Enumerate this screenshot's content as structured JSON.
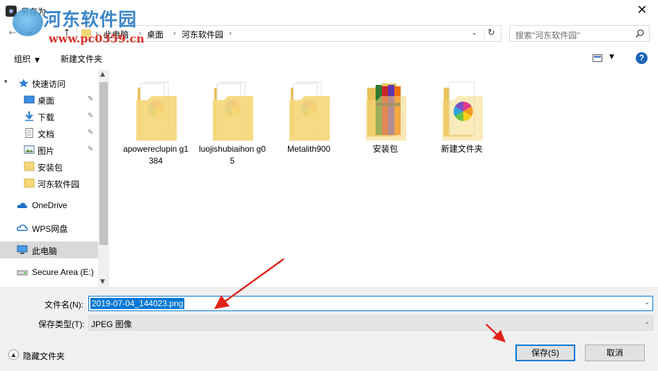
{
  "window": {
    "title": "另存为",
    "close_glyph": "✕"
  },
  "watermark": {
    "title": "河东软件园",
    "url": "www.pc0359.cn"
  },
  "address": {
    "back_glyph": "←",
    "forward_glyph": "→",
    "up_glyph": "↑",
    "crumbs": [
      "此电脑",
      "桌面",
      "河东软件园"
    ],
    "sep_glyph": "›",
    "dropdown_glyph": "⌄",
    "refresh_glyph": "↻"
  },
  "search": {
    "placeholder": "搜索\"河东软件园\""
  },
  "toolbar": {
    "organize_label": "组织",
    "new_folder_label": "新建文件夹",
    "help_glyph": "?"
  },
  "navpane": {
    "items": [
      {
        "label": "快速访问",
        "icon": "star-icon",
        "pinned": false
      },
      {
        "label": "桌面",
        "icon": "desktop-icon",
        "pinned": true
      },
      {
        "label": "下载",
        "icon": "download-icon",
        "pinned": true
      },
      {
        "label": "文档",
        "icon": "document-icon",
        "pinned": true
      },
      {
        "label": "图片",
        "icon": "picture-icon",
        "pinned": true
      },
      {
        "label": "安装包",
        "icon": "folder-icon",
        "pinned": false
      },
      {
        "label": "河东软件园",
        "icon": "folder-icon",
        "pinned": false
      },
      {
        "label": "OneDrive",
        "icon": "cloud-icon",
        "pinned": false
      },
      {
        "label": "WPS网盘",
        "icon": "cloud-icon",
        "pinned": false
      },
      {
        "label": "此电脑",
        "icon": "computer-icon",
        "pinned": false
      },
      {
        "label": "Secure Area (E:)",
        "icon": "drive-icon",
        "pinned": false
      }
    ],
    "pin_glyph": "📌"
  },
  "files": [
    {
      "name": "apowereclupin g1384",
      "thumb": "pinwheel"
    },
    {
      "name": "luojishubiaihon g05",
      "thumb": "pinwheel"
    },
    {
      "name": "Metalith900",
      "thumb": "pinwheel"
    },
    {
      "name": "安装包",
      "thumb": "archive"
    },
    {
      "name": "新建文件夹",
      "thumb": "pinwheel-front"
    }
  ],
  "form": {
    "filename_label": "文件名(N):",
    "filename_value": "2019-07-04_144023.png",
    "type_label": "保存类型(T):",
    "type_value": "JPEG 图像",
    "hide_folders_label": "隐藏文件夹",
    "save_label": "保存(S)",
    "cancel_label": "取消"
  },
  "colors": {
    "accent": "#0078d7",
    "folder": "#f5d77a",
    "annotation": "#e2231a"
  }
}
